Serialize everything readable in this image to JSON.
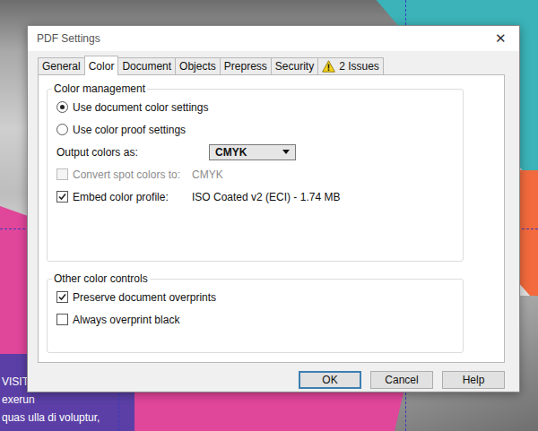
{
  "background": {
    "text_lines": [
      "VISIT T",
      "exerun",
      "quas ulla di voluptur,"
    ]
  },
  "window": {
    "title": "PDF Settings",
    "close": "✕"
  },
  "tabs": [
    {
      "label": "General",
      "selected": false,
      "warning": false
    },
    {
      "label": "Color",
      "selected": true,
      "warning": false
    },
    {
      "label": "Document",
      "selected": false,
      "warning": false
    },
    {
      "label": "Objects",
      "selected": false,
      "warning": false
    },
    {
      "label": "Prepress",
      "selected": false,
      "warning": false
    },
    {
      "label": "Security",
      "selected": false,
      "warning": false
    },
    {
      "label": "2 Issues",
      "selected": false,
      "warning": true
    }
  ],
  "color_management": {
    "title": "Color management",
    "options": [
      {
        "label": "Use document color settings",
        "selected": true
      },
      {
        "label": "Use color proof settings",
        "selected": false
      }
    ],
    "output": {
      "label": "Output colors as:",
      "value": "CMYK"
    },
    "convert_spot": {
      "label": "Convert spot colors to:",
      "value": "CMYK",
      "checked": false,
      "disabled": true
    },
    "embed_profile": {
      "label": "Embed color profile:",
      "value": "ISO Coated v2 (ECI) - 1.74 MB",
      "checked": true,
      "disabled": false
    }
  },
  "other_controls": {
    "title": "Other color controls",
    "checkboxes": [
      {
        "label": "Preserve document overprints",
        "checked": true
      },
      {
        "label": "Always overprint black",
        "checked": false
      }
    ]
  },
  "buttons": [
    {
      "label": "OK",
      "default": true
    },
    {
      "label": "Cancel",
      "default": false
    },
    {
      "label": "Help",
      "default": false
    }
  ]
}
